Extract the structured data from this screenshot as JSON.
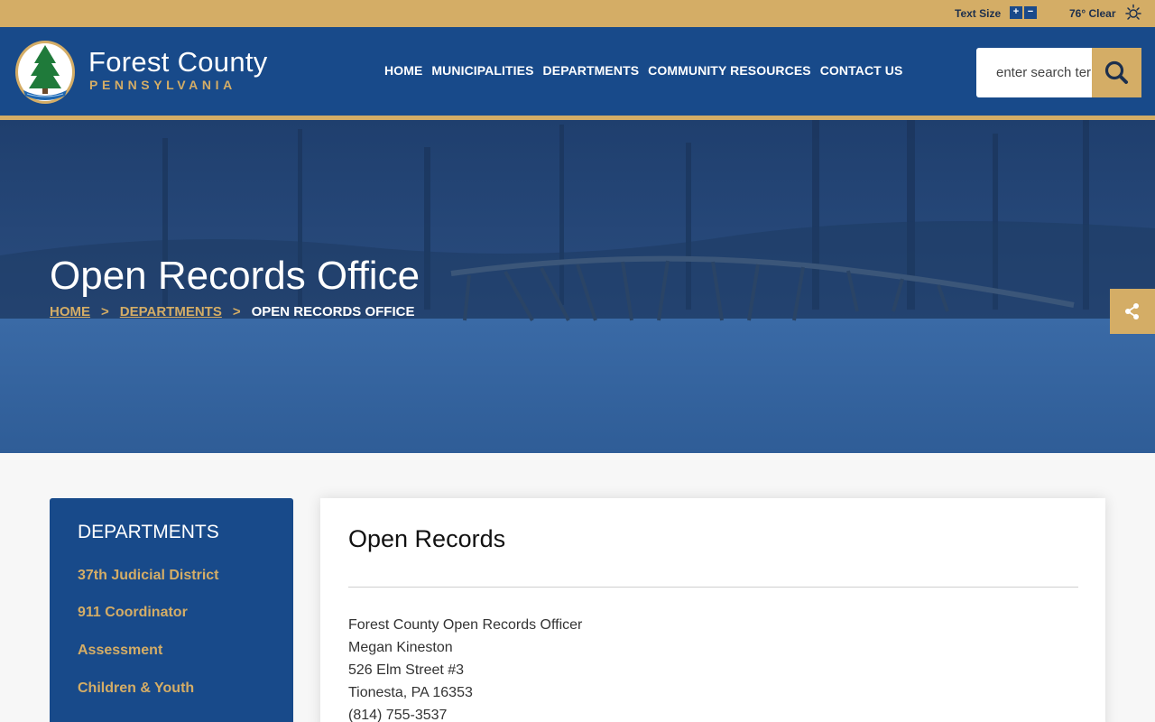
{
  "utility": {
    "text_size_label": "Text Size",
    "plus_label": "+",
    "minus_label": "−",
    "weather": "76° Clear",
    "weather_icon": "sun-icon"
  },
  "header": {
    "logo_title": "Forest County",
    "logo_subtitle": "PENNSYLVANIA",
    "nav": [
      "HOME",
      "MUNICIPALITIES",
      "DEPARTMENTS",
      "COMMUNITY RESOURCES",
      "CONTACT US"
    ],
    "search_placeholder": "enter search terms",
    "search_icon": "search-icon"
  },
  "hero": {
    "title": "Open Records Office",
    "breadcrumb": {
      "home": "HOME",
      "departments": "DEPARTMENTS",
      "separator": ">",
      "current": "OPEN RECORDS OFFICE"
    },
    "share_icon": "share-icon"
  },
  "sidebar": {
    "title": "DEPARTMENTS",
    "items": [
      "37th Judicial District",
      "911 Coordinator",
      "Assessment",
      "Children & Youth"
    ]
  },
  "main": {
    "title": "Open Records",
    "address": [
      "Forest County Open Records Officer",
      "Megan Kineston",
      "526 Elm Street #3",
      "Tionesta, PA 16353",
      "(814) 755-3537"
    ]
  },
  "colors": {
    "navy": "#184a8a",
    "gold": "#d4ad66",
    "hero_overlay": "#2c5288"
  }
}
